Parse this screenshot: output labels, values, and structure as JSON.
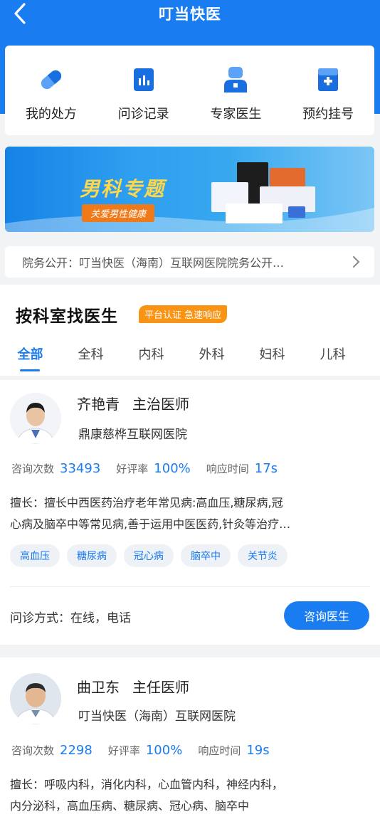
{
  "nav": {
    "title": "叮当快医"
  },
  "quick": [
    {
      "label": "我的处方",
      "icon": "capsule-icon"
    },
    {
      "label": "问诊记录",
      "icon": "records-icon"
    },
    {
      "label": "专家医生",
      "icon": "doctor-icon"
    },
    {
      "label": "预约挂号",
      "icon": "appointment-icon"
    }
  ],
  "banner": {
    "title": "男科专题",
    "subtitle": "关爱男性健康"
  },
  "notice": {
    "text": "院务公开：叮当快医（海南）互联网医院院务公开…"
  },
  "dept": {
    "heading": "按科室找医生",
    "badge": "平台认证 急速响应",
    "tabs": [
      "全部",
      "全科",
      "内科",
      "外科",
      "妇科",
      "儿科"
    ]
  },
  "doctors": [
    {
      "name": "齐艳青",
      "title": "主治医师",
      "hospital": "鼎康慈桦互联网医院",
      "consult_label": "咨询次数",
      "consult": "33493",
      "rating_label": "好评率",
      "rating": "100%",
      "response_label": "响应时间",
      "response": "17s",
      "good_line1": "擅长：擅长中西医药治疗老年常见病:高血压,糖尿病,冠",
      "good_line2": "心病及脑卒中等常见病,善于运用中医医药,针灸等治疗…",
      "tags": [
        "高血压",
        "糖尿病",
        "冠心病",
        "脑卒中",
        "关节炎"
      ],
      "mode": "问诊方式：在线，电话",
      "button": "咨询医生"
    },
    {
      "name": "曲卫东",
      "title": "主任医师",
      "hospital": "叮当快医（海南）互联网医院",
      "consult_label": "咨询次数",
      "consult": "2298",
      "rating_label": "好评率",
      "rating": "100%",
      "response_label": "响应时间",
      "response": "19s",
      "good_line1": "擅长：呼吸内科，消化内科，心血管内科，神经内科，",
      "good_line2": "内分泌科，高血压病、糖尿病、冠心病、脑卒中"
    }
  ],
  "colors": {
    "primary": "#1a7cf1",
    "orange": "#f99314",
    "banner_title": "#ffd84a"
  }
}
